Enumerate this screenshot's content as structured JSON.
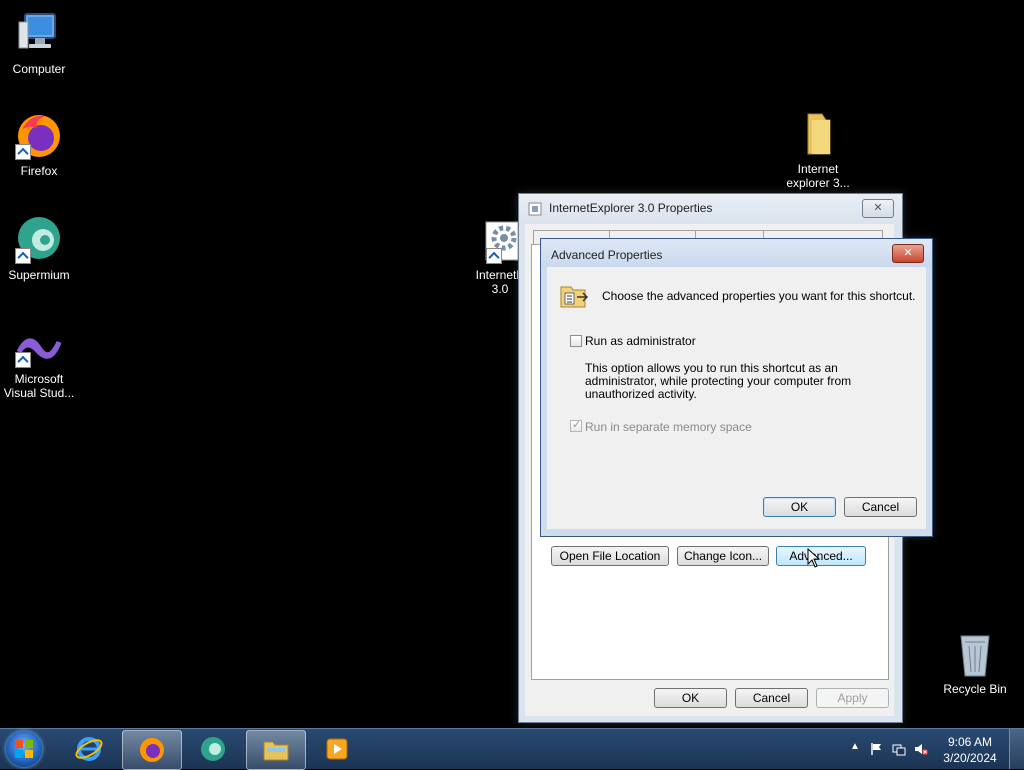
{
  "desktop": {
    "icons": {
      "computer": "Computer",
      "firefox": "Firefox",
      "supermium": "Supermium",
      "vs_line1": "Microsoft",
      "vs_line2": "Visual Stud...",
      "folder_line1": "Internet",
      "folder_line2": "explorer 3...",
      "ie_line1": "InternetE",
      "ie_line2": "3.0",
      "recycle": "Recycle Bin"
    }
  },
  "properties_window": {
    "title": "InternetExplorer 3.0 Properties",
    "close_label": "✕",
    "buttons": {
      "open_file_location": "Open File Location",
      "change_icon": "Change Icon...",
      "advanced": "Advanced...",
      "ok": "OK",
      "cancel": "Cancel",
      "apply": "Apply"
    }
  },
  "advanced_dialog": {
    "title": "Advanced Properties",
    "close_label": "✕",
    "header_text": "Choose the advanced properties you want for this shortcut.",
    "run_as_admin_label": "Run as administrator",
    "run_as_admin_checked": false,
    "description_line1": "This option allows you to run this shortcut as an",
    "description_line2": "administrator, while protecting your computer from",
    "description_line3": "unauthorized activity.",
    "separate_memory_label": "Run in separate memory space",
    "separate_memory_checked": true,
    "ok_label": "OK",
    "cancel_label": "Cancel"
  },
  "taskbar": {
    "clock_time": "9:06 AM",
    "clock_date": "3/20/2024"
  }
}
